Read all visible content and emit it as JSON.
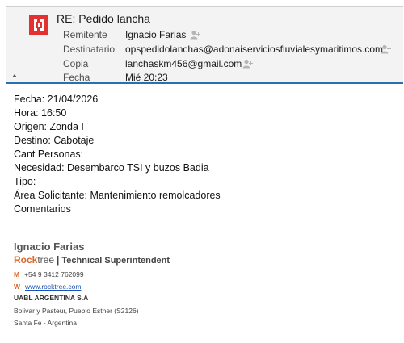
{
  "header": {
    "subject": "RE: Pedido lancha",
    "fields": [
      {
        "label": "Remitente",
        "value": "Ignacio Farias"
      },
      {
        "label": "Destinatario",
        "value": "opspedidolanchas@adonaiserviciosfluvialesymaritimos.com"
      },
      {
        "label": "Copia",
        "value": "lanchaskm456@gmail.com"
      },
      {
        "label": "Fecha",
        "value": "Mié 20:23"
      }
    ],
    "icons": {
      "app": "app-logo-icon",
      "contact": "add-contact-icon",
      "collapse": "collapse-arrow-icon"
    },
    "colors": {
      "accent": "#2a6fb0",
      "brand": "#e3312f"
    }
  },
  "body": {
    "lines": [
      "Fecha: 21/04/2026",
      "Hora: 16:50",
      "Origen: Zonda I",
      "Destino: Cabotaje",
      "Cant Personas:",
      "Necesidad: Desembarco TSI y buzos Badia",
      "Tipo:",
      "Área Solicitante: Mantenimiento remolcadores",
      "Comentarios"
    ]
  },
  "signature": {
    "name": "Ignacio Farias",
    "brand_rock": "Rock",
    "brand_tree": "tree",
    "separator": "|",
    "role": "Technical Superintendent",
    "phone_marker": "M",
    "phone": "+54 9 3412 762099",
    "web_marker": "W",
    "web": "www.rocktree.com",
    "company": "UABL ARGENTINA S.A",
    "address": "Bolivar y Pasteur, Pueblo Esther (S2126)",
    "region": "Santa Fe - Argentina",
    "colors": {
      "brand_orange": "#d9682a",
      "link": "#1a4fb3"
    }
  }
}
